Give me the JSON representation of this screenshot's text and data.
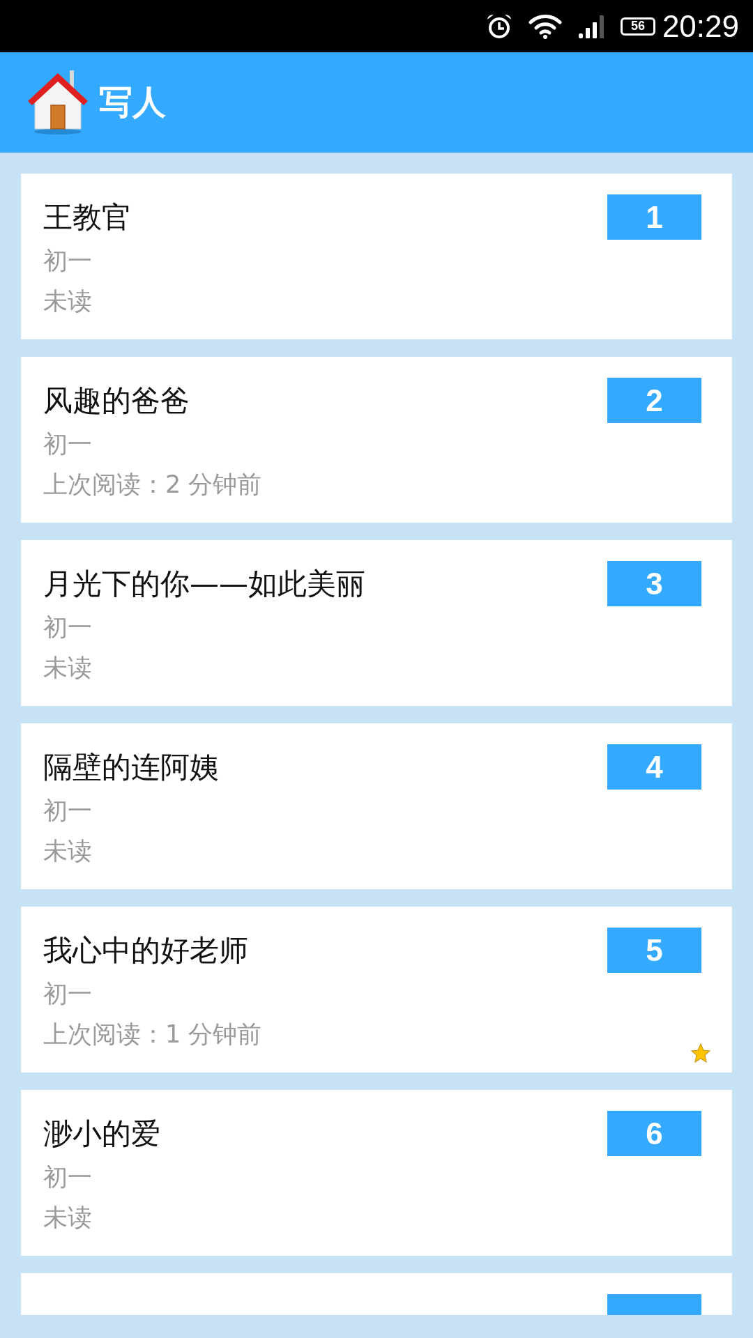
{
  "status_bar": {
    "battery": "56",
    "time": "20:29"
  },
  "app_bar": {
    "title": "写人"
  },
  "articles": [
    {
      "title": "王教官",
      "grade": "初一",
      "read_status": "未读",
      "number": "1",
      "starred": false
    },
    {
      "title": "风趣的爸爸",
      "grade": "初一",
      "read_status": "上次阅读：2 分钟前",
      "number": "2",
      "starred": false
    },
    {
      "title": "月光下的你——如此美丽",
      "grade": "初一",
      "read_status": "未读",
      "number": "3",
      "starred": false
    },
    {
      "title": "隔壁的连阿姨",
      "grade": "初一",
      "read_status": "未读",
      "number": "4",
      "starred": false
    },
    {
      "title": "我心中的好老师",
      "grade": "初一",
      "read_status": "上次阅读：1 分钟前",
      "number": "5",
      "starred": true
    },
    {
      "title": "渺小的爱",
      "grade": "初一",
      "read_status": "未读",
      "number": "6",
      "starred": false
    },
    {
      "starred": false
    }
  ]
}
